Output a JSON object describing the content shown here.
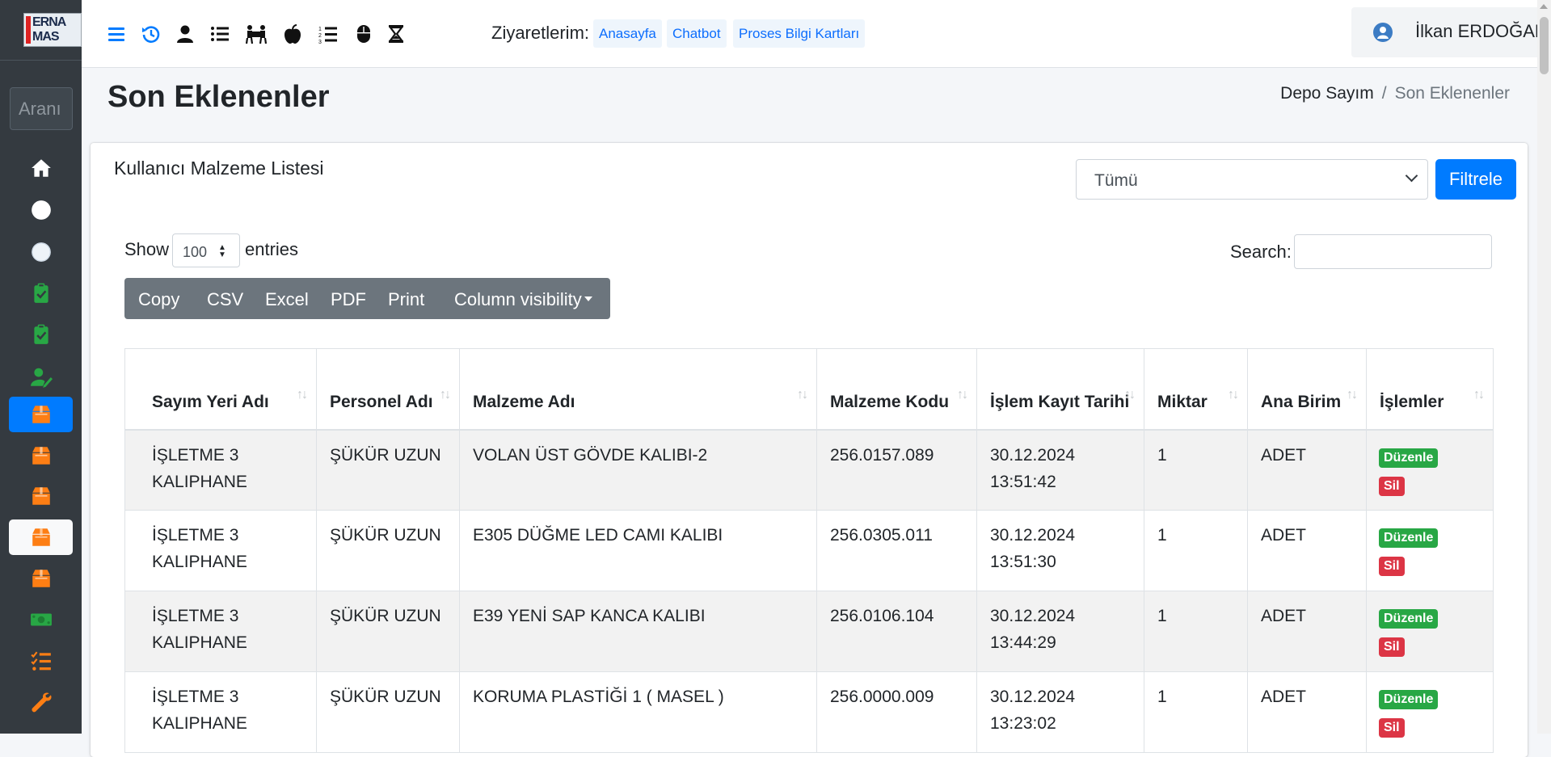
{
  "sidebar": {
    "logo_text_top": "ERNA",
    "logo_text_bottom": "MAS",
    "search_placeholder": "Aranı",
    "items": [
      {
        "icon": "home-icon",
        "color": "#ffffff"
      },
      {
        "icon": "circle-icon",
        "color": "#ffffff"
      },
      {
        "icon": "circle-outline-icon",
        "color": "#eef3f8"
      },
      {
        "icon": "clipboard-check-icon",
        "color": "#28a745"
      },
      {
        "icon": "clipboard-check-icon",
        "color": "#28a745"
      },
      {
        "icon": "user-edit-icon",
        "color": "#28a745"
      },
      {
        "icon": "box-icon",
        "color": "#fd7e14",
        "state": "active-blue"
      },
      {
        "icon": "box-icon",
        "color": "#fd7e14"
      },
      {
        "icon": "box-icon",
        "color": "#fd7e14"
      },
      {
        "icon": "box-icon",
        "color": "#fd7e14",
        "state": "active-white"
      },
      {
        "icon": "box-icon",
        "color": "#fd7e14"
      },
      {
        "icon": "money-icon",
        "color": "#28a745"
      },
      {
        "icon": "tasks-icon",
        "color": "#fd7e14"
      },
      {
        "icon": "wrench-icon",
        "color": "#fd7e14"
      }
    ]
  },
  "navbar": {
    "icons": [
      "menu-icon",
      "history-icon",
      "user-icon",
      "list-icon",
      "people-carry-icon",
      "apple-icon",
      "ordered-list-icon",
      "mouse-icon",
      "hourglass-icon"
    ],
    "visits_label": "Ziyaretlerim:",
    "visit_links": [
      "Anasayfa",
      "Chatbot",
      "Proses Bilgi Kartları"
    ],
    "user_name": "İlkan ERDOĞAN"
  },
  "header": {
    "title": "Son Eklenenler",
    "breadcrumb_home": "Depo Sayım",
    "breadcrumb_sep": "/",
    "breadcrumb_current": "Son Eklenenler"
  },
  "card": {
    "title": "Kullanıcı Malzeme Listesi",
    "filter_value": "Tümü",
    "filter_button": "Filtrele",
    "show_label": "Show",
    "entries_value": "100",
    "entries_label": "entries",
    "search_label": "Search:",
    "buttons": [
      "Copy",
      "CSV",
      "Excel",
      "PDF",
      "Print",
      "Column visibility"
    ]
  },
  "table": {
    "columns": [
      "Sayım Yeri Adı",
      "Personel Adı",
      "Malzeme Adı",
      "Malzeme Kodu",
      "İşlem Kayıt Tarihi",
      "Miktar",
      "Ana Birim",
      "İşlemler"
    ],
    "edit_label": "Düzenle",
    "delete_label": "Sil",
    "rows": [
      {
        "yer": "İŞLETME 3 KALIPHANE",
        "personel": "ŞÜKÜR UZUN",
        "malzeme": "VOLAN ÜST GÖVDE KALIBI-2",
        "kod": "256.0157.089",
        "tarih": "30.12.2024 13:51:42",
        "miktar": "1",
        "birim": "ADET"
      },
      {
        "yer": "İŞLETME 3 KALIPHANE",
        "personel": "ŞÜKÜR UZUN",
        "malzeme": "E305 DÜĞME LED CAMI KALIBI",
        "kod": "256.0305.011",
        "tarih": "30.12.2024 13:51:30",
        "miktar": "1",
        "birim": "ADET"
      },
      {
        "yer": "İŞLETME 3 KALIPHANE",
        "personel": "ŞÜKÜR UZUN",
        "malzeme": "E39 YENİ SAP KANCA KALIBI",
        "kod": "256.0106.104",
        "tarih": "30.12.2024 13:44:29",
        "miktar": "1",
        "birim": "ADET"
      },
      {
        "yer": "İŞLETME 3 KALIPHANE",
        "personel": "ŞÜKÜR UZUN",
        "malzeme": "KORUMA PLASTİĞİ 1 ( MASEL )",
        "kod": "256.0000.009",
        "tarih": "30.12.2024 13:23:02",
        "miktar": "1",
        "birim": "ADET"
      }
    ]
  }
}
